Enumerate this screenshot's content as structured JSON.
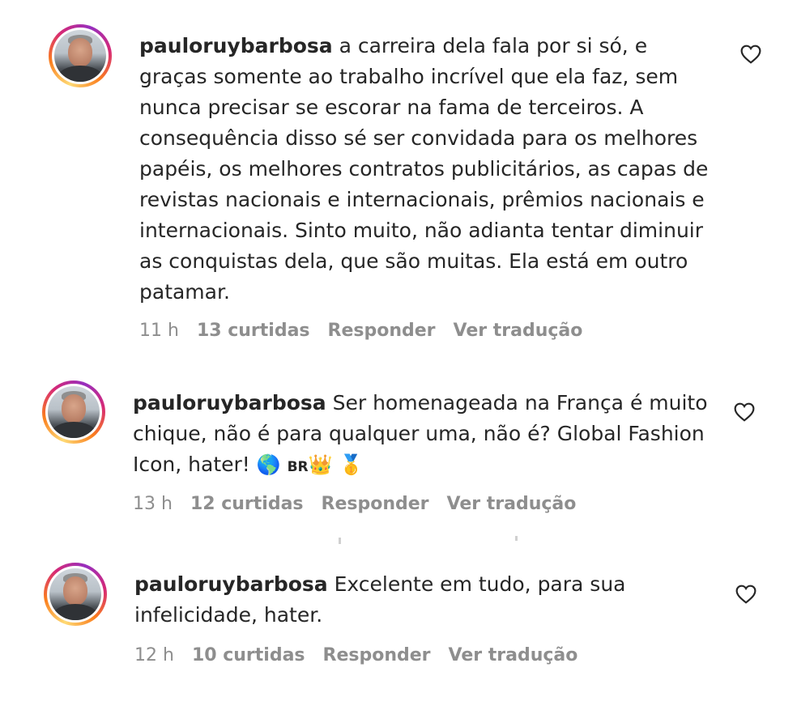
{
  "comments": [
    {
      "username": "pauloruybarbosa",
      "text": " a carreira dela fala por si só, e graças somente ao trabalho incrível que ela faz, sem nunca precisar se escorar na fama de terceiros. A consequência disso sé ser convidada para os melhores papéis, os melhores contratos publicitários, as capas de revistas nacionais e internacionais, prêmios nacionais e internacionais. Sinto muito, não adianta tentar diminuir as conquistas dela, que são muitas. Ela está em outro patamar.",
      "time": "11 h",
      "likes": "13 curtidas",
      "reply": "Responder",
      "translate": "Ver tradução"
    },
    {
      "username": "pauloruybarbosa",
      "text": " Ser homenageada na França é muito chique, não é para qualquer uma, não é? Global Fashion Icon, hater! ",
      "emojis": {
        "globe": "🌎",
        "flag": "BR",
        "crown": "👑",
        "medal": "🥇"
      },
      "time": "13 h",
      "likes": "12 curtidas",
      "reply": "Responder",
      "translate": "Ver tradução"
    },
    {
      "username": "pauloruybarbosa",
      "text": " Excelente em tudo, para sua infelicidade, hater.",
      "time": "12 h",
      "likes": "10 curtidas",
      "reply": "Responder",
      "translate": "Ver tradução"
    }
  ],
  "icons": {
    "like": "heart-icon"
  },
  "colors": {
    "text": "#262626",
    "meta": "#8e8e8e",
    "ring": "#d62976"
  }
}
